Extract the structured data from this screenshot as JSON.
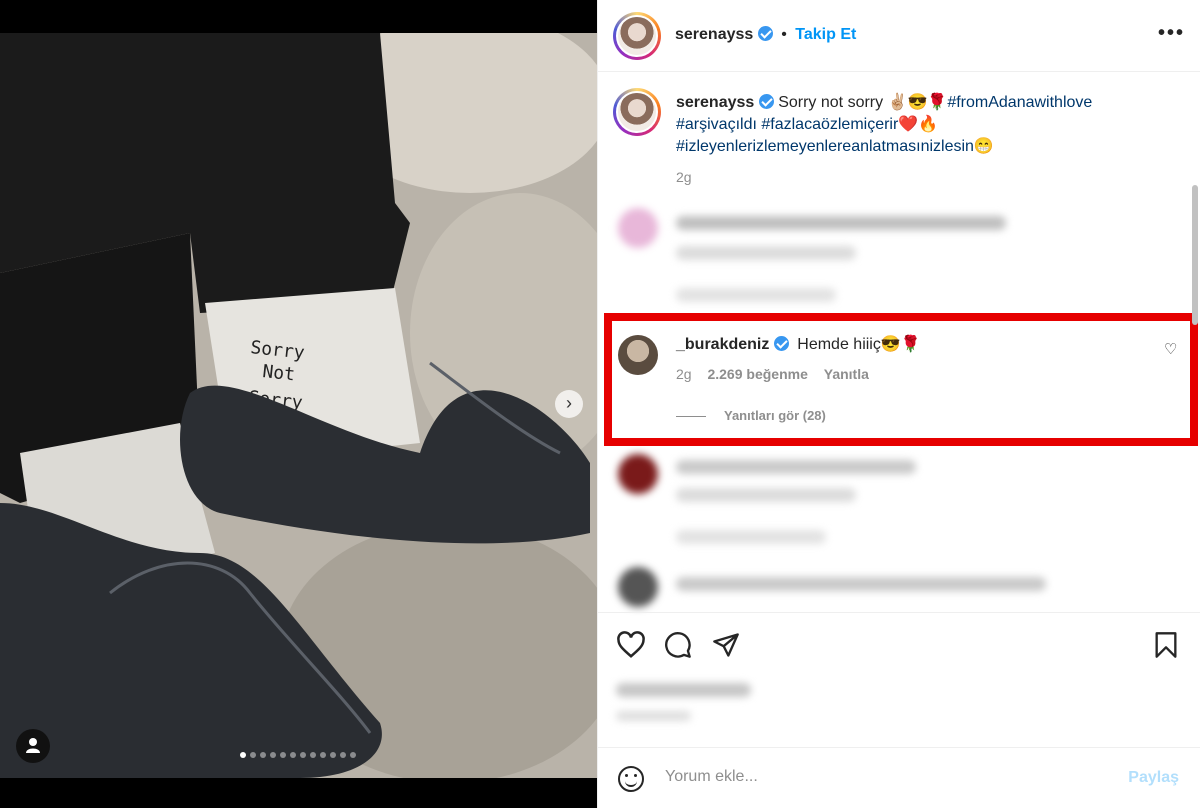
{
  "post": {
    "username": "serenayss",
    "follow_label": "Takip Et",
    "bullet": "•",
    "more_icon": "more-horizontal-icon"
  },
  "caption": {
    "username": "serenayss",
    "text_start": "Sorry not sorry ✌🏼😎🌹",
    "hashtag1": "#fromAdanawithlove",
    "hashtag2": "#arşivaçıldı",
    "hashtag3": "#fazlacaözlemiçerir",
    "emoji1": "❤️🔥",
    "hashtag4": "#izleyenlerizlemeyenlereanlatmasınizlesin",
    "emoji2": "😁",
    "time": "2g"
  },
  "highlighted_comment": {
    "username": "_burakdeniz",
    "text": "Hemde hiiiç😎🌹",
    "time": "2g",
    "likes": "2.269 beğenme",
    "reply": "Yanıtla",
    "view_replies": "Yanıtları gör (28)"
  },
  "carousel": {
    "total": 12,
    "active": 0
  },
  "add_comment": {
    "placeholder": "Yorum ekle...",
    "share": "Paylaş"
  },
  "colors": {
    "highlight": "#e60000",
    "link": "#0095f6",
    "hashtag": "#00376b"
  }
}
